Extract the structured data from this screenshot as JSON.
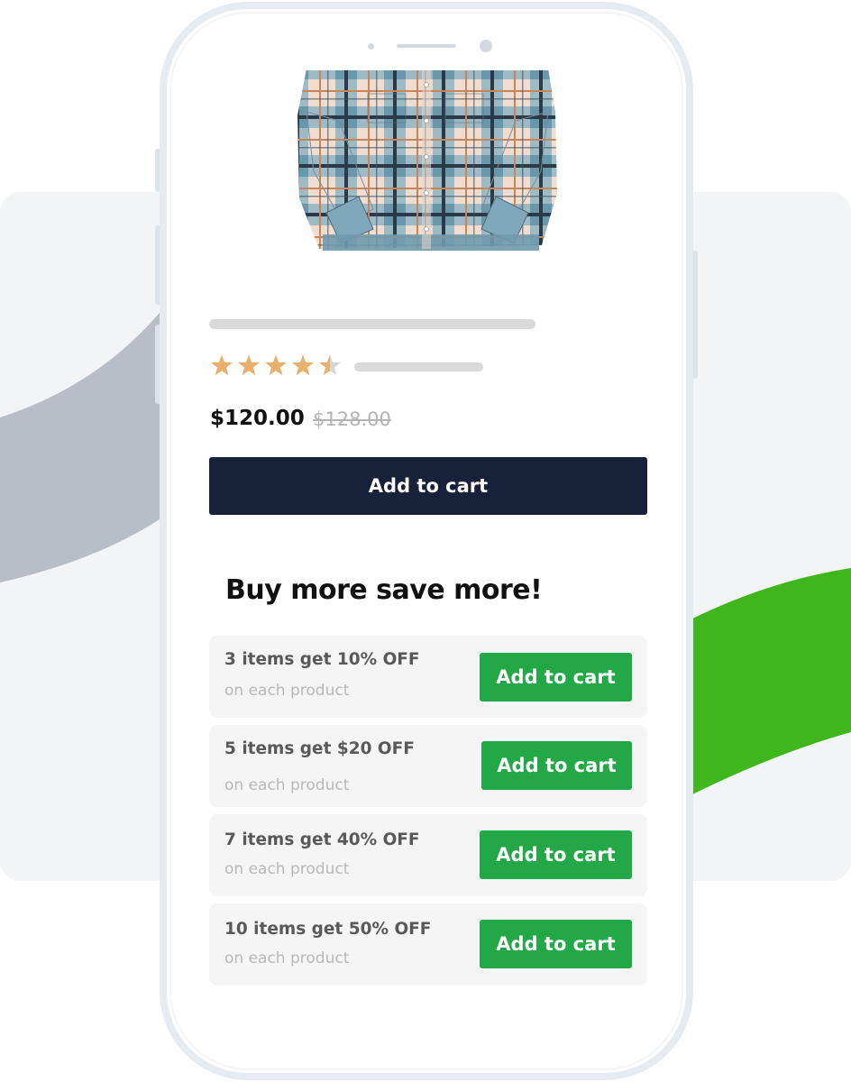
{
  "product": {
    "image_icon": "plaid-flannel-jacket-image",
    "rating": 4.5,
    "rating_max": 5,
    "price": "$120.00",
    "compare_price": "$128.00",
    "add_to_cart_label": "Add to cart"
  },
  "offer": {
    "title": "Buy more save more!",
    "tiers": [
      {
        "title": "3 items get 10% OFF",
        "subtitle": "on each product",
        "button": "Add to cart"
      },
      {
        "title": "5 items get $20 OFF",
        "subtitle": "on each product",
        "button": "Add to cart"
      },
      {
        "title": "7 items get 40% OFF",
        "subtitle": "on each product",
        "button": "Add to cart"
      },
      {
        "title": "10 items get 50% OFF",
        "subtitle": "on each product",
        "button": "Add to cart"
      }
    ]
  },
  "colors": {
    "primary_button": "#17213a",
    "tier_button": "#22a847",
    "star": "#e8b06b",
    "accent_green": "#3fb61c",
    "accent_gray": "#b8bec5"
  }
}
